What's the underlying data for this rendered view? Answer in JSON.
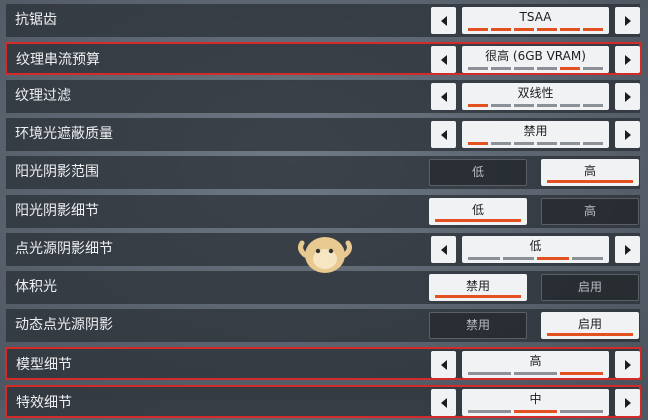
{
  "settings": [
    {
      "label": "抗锯齿",
      "type": "selector",
      "value": "TSAA",
      "segments": [
        1,
        1,
        1,
        1,
        1,
        1
      ],
      "highlighted": false
    },
    {
      "label": "纹理串流预算",
      "type": "selector",
      "value": "很高 (6GB VRAM)",
      "segments": [
        0,
        0,
        0,
        0,
        1,
        0
      ],
      "highlighted": true
    },
    {
      "label": "纹理过滤",
      "type": "selector",
      "value": "双线性",
      "segments": [
        1,
        0,
        0,
        0,
        0,
        0
      ],
      "highlighted": false
    },
    {
      "label": "环境光遮蔽质量",
      "type": "selector",
      "value": "禁用",
      "segments": [
        1,
        0,
        0,
        0,
        0,
        0
      ],
      "highlighted": false
    },
    {
      "label": "阳光阴影范围",
      "type": "toggle",
      "options": [
        "低",
        "高"
      ],
      "active": 1,
      "highlighted": false
    },
    {
      "label": "阳光阴影细节",
      "type": "toggle",
      "options": [
        "低",
        "高"
      ],
      "active": 0,
      "highlighted": false
    },
    {
      "label": "点光源阴影细节",
      "type": "selector",
      "value": "低",
      "segments": [
        0,
        0,
        1,
        0
      ],
      "highlighted": false
    },
    {
      "label": "体积光",
      "type": "toggle",
      "options": [
        "禁用",
        "启用"
      ],
      "active": 0,
      "highlighted": false
    },
    {
      "label": "动态点光源阴影",
      "type": "toggle",
      "options": [
        "禁用",
        "启用"
      ],
      "active": 1,
      "highlighted": false
    },
    {
      "label": "模型细节",
      "type": "selector",
      "value": "高",
      "segments": [
        0,
        0,
        1
      ],
      "highlighted": true
    },
    {
      "label": "特效细节",
      "type": "selector",
      "value": "中",
      "segments": [
        0,
        1,
        0
      ],
      "highlighted": true
    }
  ],
  "colors": {
    "accent": "#e2511f",
    "highlight_border": "#d32a2a"
  }
}
